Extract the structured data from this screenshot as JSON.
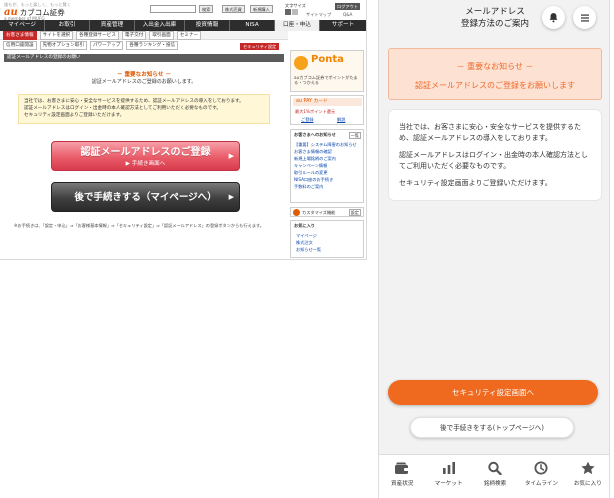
{
  "pc": {
    "tagline": "誰もが、もっと楽しく、もっと賢く",
    "logo_brand": "au",
    "logo_name": "カブコム証券",
    "logo_sub": "a member of MUFG",
    "header_search_btn": "検索",
    "header_links": [
      "株式売買",
      "新規購入"
    ],
    "font_size_label": "文字サイズ",
    "logout": "ログアウト",
    "header_mini": [
      "サイトマップ",
      "Q&A"
    ],
    "nav": [
      "マイページ",
      "お取引",
      "資産管理",
      "入出金入出庫",
      "投資情報",
      "NISA",
      "口座・申込",
      "サポート"
    ],
    "subnav1": [
      "お客さま情報",
      "サイトを選択",
      "各種登録サービス",
      "電子交付",
      "取引画面",
      "セミナー"
    ],
    "subnav2": [
      "信用口座開設",
      "先物オプション取引",
      "パワーアップ",
      "各種ランキング・投信"
    ],
    "security_tag": "セキュリティ設定",
    "page_bar": "認証メールアドレスの登録のお願い",
    "notice_title": "－ 重要なお知らせ －",
    "notice_sub": "認証メールアドレスのご登録のお願いします。",
    "body_text": [
      "当社では、お客さまに安心・安全なサービスを提供するため、認証メールアドレスの導入をしております。",
      "認証メールアドレスはログイン・出金時の本人確認方法としてご利用いただく必要なものです。",
      "セキュリティ設定画面よりご登録いただけます。"
    ],
    "btn_red_main": "認証メールアドレスのご登録",
    "btn_red_sub": "手続き画面へ",
    "btn_gray": "後で手続きする（マイページへ）",
    "footer_note": "※お手続きは、「設定・申込」⇒「お客様基本情報」⇒「セキュリティ設定」⇒「認証メールアドレス」の登録ボタンからも行えます。",
    "ponta_brand": "Ponta",
    "ponta_text": "auカブコム証券でポイントがたまる・つかえる",
    "aupay_title": "au PAY カード",
    "aupay_text": "最大1%ポイント還元",
    "side_links": [
      "ご登録",
      "解説"
    ],
    "favorites_title": "お客さまへのお知らせ",
    "favorites_more": "一覧",
    "fav_items": [
      "【重要】システム障害のお知らせ",
      "お客さま情報の確認",
      "新規上場銘柄のご案内",
      "キャンペーン情報",
      "取引ルールの変更",
      "NISA口座のお手続き",
      "手数料のご案内"
    ],
    "custom_label": "カスタマイズ機能",
    "custom_btn": "設定",
    "okiniiri_title": "お気に入り",
    "okiniiri_items": [
      "マイページ",
      "株式注文",
      "お知らせ一覧"
    ]
  },
  "mobile": {
    "title_line1": "メールアドレス",
    "title_line2": "登録方法のご案内",
    "notice_line1": "－ 重要なお知らせ －",
    "notice_line2": "認証メールアドレスのご登録をお願いします",
    "body1": "当社では、お客さまに安心・安全なサービスを提供するため、認証メールアドレスの導入をしております。",
    "body2": "認証メールアドレスはログイン・出金時の本人確認方法としてご利用いただく必要なものです。",
    "body3": "セキュリティ設定画面よりご登録いただけます。",
    "primary_btn": "セキュリティ設定画面へ",
    "secondary_btn": "後で手続きをする(トップページへ)",
    "tabs": [
      "資産状況",
      "マーケット",
      "銘柄検索",
      "タイムライン",
      "お気に入り"
    ]
  },
  "colors": {
    "pc_red": "#e95c69",
    "pc_nav": "#2d2d2d",
    "mobile_orange": "#ef6a1f",
    "notice_bg": "#fde2d4"
  }
}
